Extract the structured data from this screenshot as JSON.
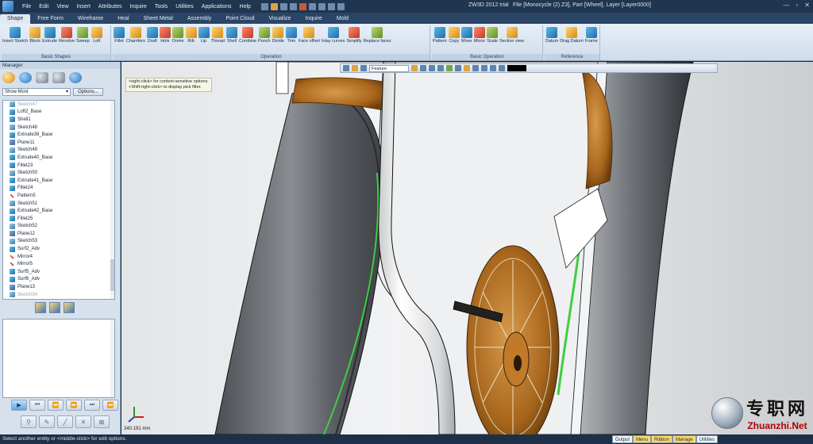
{
  "menu": [
    "File",
    "Edit",
    "View",
    "Insert",
    "Attributes",
    "Inquire",
    "Tools",
    "Utilities",
    "Applications",
    "Help"
  ],
  "title": "ZW3D 2012 trial",
  "file_info": "File [Monocycle (2).Z3], Part [Wheel], Layer [Layer0000]",
  "tabs": [
    "Shape",
    "Free Form",
    "Wireframe",
    "Heal",
    "Sheet Metal",
    "Assembly",
    "Point Cloud",
    "Visualize",
    "Inquire",
    "Mold"
  ],
  "ribbon": {
    "groups": [
      {
        "caption": "Basic Shapes",
        "items": [
          "Insert Sketch",
          "Block",
          "Extrude",
          "Revolve",
          "Sweep",
          "Loft"
        ]
      },
      {
        "caption": "Operation",
        "items": [
          "Fillet",
          "Chamfers",
          "Draft",
          "Hole",
          "Dome",
          "Rib",
          "Lip",
          "Thread",
          "Shell",
          "Combine",
          "Punch",
          "Divide",
          "Trim",
          "Face offset",
          "Inlay curves",
          "Simplify",
          "Replace faces"
        ]
      },
      {
        "caption": "Basic Operation",
        "items": [
          "Pattern",
          "Copy",
          "Move",
          "Mirror",
          "Scale",
          "Section view"
        ]
      },
      {
        "caption": "Reference",
        "items": [
          "Datum",
          "Drag Datum",
          "Frame"
        ]
      }
    ]
  },
  "manager": {
    "title": "Manager",
    "filter": "Show Most",
    "options_label": "Options...",
    "items": [
      {
        "label": "Sketch47",
        "type": "sk",
        "dim": true
      },
      {
        "label": "Loft2_Base",
        "type": "sh"
      },
      {
        "label": "Shell1",
        "type": "sh"
      },
      {
        "label": "Sketch48",
        "type": "sk"
      },
      {
        "label": "Extrude39_Base",
        "type": "sh"
      },
      {
        "label": "Plane11",
        "type": "pl"
      },
      {
        "label": "Sketch49",
        "type": "sk"
      },
      {
        "label": "Extrude40_Base",
        "type": "sh"
      },
      {
        "label": "Fillet23",
        "type": "sh"
      },
      {
        "label": "Sketch50",
        "type": "sk"
      },
      {
        "label": "Extrude41_Base",
        "type": "sh"
      },
      {
        "label": "Fillet24",
        "type": "sh"
      },
      {
        "label": "Pattern5",
        "type": "ln"
      },
      {
        "label": "Sketch51",
        "type": "sk"
      },
      {
        "label": "Extrude42_Base",
        "type": "sh"
      },
      {
        "label": "Fillet25",
        "type": "sh"
      },
      {
        "label": "Sketch52",
        "type": "sk"
      },
      {
        "label": "Plane12",
        "type": "pl"
      },
      {
        "label": "Sketch53",
        "type": "sk"
      },
      {
        "label": "Surf2_Adv",
        "type": "sh"
      },
      {
        "label": "Mirror4",
        "type": "ln"
      },
      {
        "label": "Mirror5",
        "type": "ln"
      },
      {
        "label": "Surf5_Adv",
        "type": "sh"
      },
      {
        "label": "Surf6_Adv",
        "type": "sh"
      },
      {
        "label": "Plane13",
        "type": "pl"
      },
      {
        "label": "Sketch34",
        "type": "sk",
        "dim": true
      }
    ]
  },
  "viewport": {
    "hint_line1": "<right-click> for context-sensitive options.",
    "hint_line2": "<Shift-right-click> to display pick filter.",
    "filter_combo": "Feature",
    "coordinate": "340.191 mm",
    "colors": {
      "tire": "#5d6166",
      "rim_green": "#3ecf3e",
      "bronze": "#a8661c"
    }
  },
  "status": {
    "text": "Select another entity or <middle-click> for edit options.",
    "tabs": [
      "Output",
      "Menu",
      "Ribbon",
      "Manage",
      "Utilities"
    ]
  },
  "watermark": {
    "cn": "专职网",
    "url": "Zhuanzhi.Net"
  }
}
